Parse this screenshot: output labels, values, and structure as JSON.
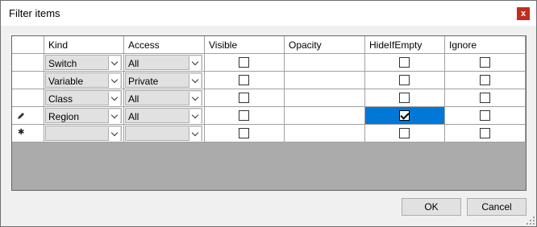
{
  "window": {
    "title": "Filter items",
    "close_label": "x"
  },
  "grid": {
    "columns": [
      "Kind",
      "Access",
      "Visible",
      "Opacity",
      "HideIfEmpty",
      "Ignore"
    ],
    "rows": [
      {
        "marker": "",
        "kind": "Switch",
        "access": "All",
        "visible": false,
        "opacity": "",
        "hide_if_empty": false,
        "ignore": false
      },
      {
        "marker": "",
        "kind": "Variable",
        "access": "Private",
        "visible": false,
        "opacity": "",
        "hide_if_empty": false,
        "ignore": false
      },
      {
        "marker": "",
        "kind": "Class",
        "access": "All",
        "visible": false,
        "opacity": "",
        "hide_if_empty": false,
        "ignore": false
      },
      {
        "marker": "pencil-icon",
        "kind": "Region",
        "access": "All",
        "visible": false,
        "opacity": "",
        "hide_if_empty": true,
        "ignore": false,
        "selected_cell": "hide_if_empty"
      },
      {
        "marker": "new-row-icon",
        "kind": "",
        "access": "",
        "visible": false,
        "opacity": "",
        "hide_if_empty": false,
        "ignore": false
      }
    ]
  },
  "buttons": {
    "ok": "OK",
    "cancel": "Cancel"
  },
  "colors": {
    "selection": "#0078d7",
    "close": "#c42b1c"
  }
}
